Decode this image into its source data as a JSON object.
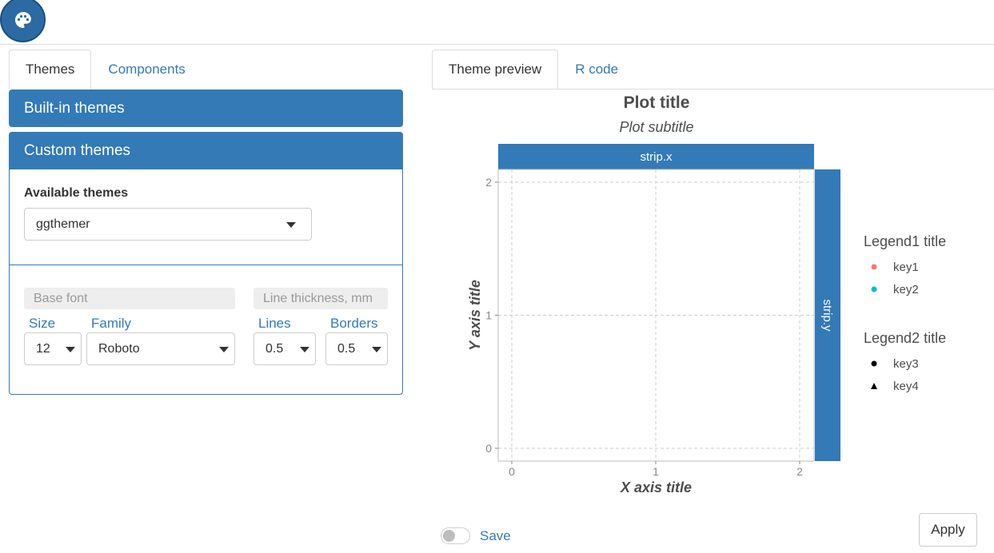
{
  "left_tabs": [
    "Themes",
    "Components"
  ],
  "right_tabs": [
    "Theme preview",
    "R code"
  ],
  "panels": {
    "builtin_title": "Built-in themes",
    "custom_title": "Custom themes"
  },
  "available_themes": {
    "label": "Available themes",
    "selected": "ggthemer"
  },
  "base_font": {
    "header": "Base font",
    "size_label": "Size",
    "size_value": "12",
    "family_label": "Family",
    "family_value": "Roboto"
  },
  "line_thickness": {
    "header": "Line thickness, mm",
    "lines_label": "Lines",
    "lines_value": "0.5",
    "borders_label": "Borders",
    "borders_value": "0.5"
  },
  "chart_data": {
    "type": "scatter",
    "title": "Plot title",
    "subtitle": "Plot subtitle",
    "xlabel": "X axis title",
    "ylabel": "Y axis title",
    "xlim": [
      0,
      2
    ],
    "ylim": [
      0,
      2
    ],
    "x_ticks": [
      "0",
      "1",
      "2"
    ],
    "y_ticks": [
      "0",
      "1",
      "2"
    ],
    "strip_x": "strip.x",
    "strip_y": "strip.y",
    "grid": true,
    "legends": [
      {
        "title": "Legend1 title",
        "keys": [
          {
            "label": "key1",
            "color": "#f8766d",
            "shape": "circle"
          },
          {
            "label": "key2",
            "color": "#00bfc4",
            "shape": "circle"
          }
        ]
      },
      {
        "title": "Legend2 title",
        "keys": [
          {
            "label": "key3",
            "color": "#000000",
            "shape": "circle"
          },
          {
            "label": "key4",
            "color": "#000000",
            "shape": "triangle"
          }
        ]
      }
    ]
  },
  "footer": {
    "save_label": "Save",
    "apply_label": "Apply"
  },
  "colors": {
    "accent": "#337ab7",
    "panel_grid": "#cccccc",
    "text_dark": "#4d4d4d"
  }
}
